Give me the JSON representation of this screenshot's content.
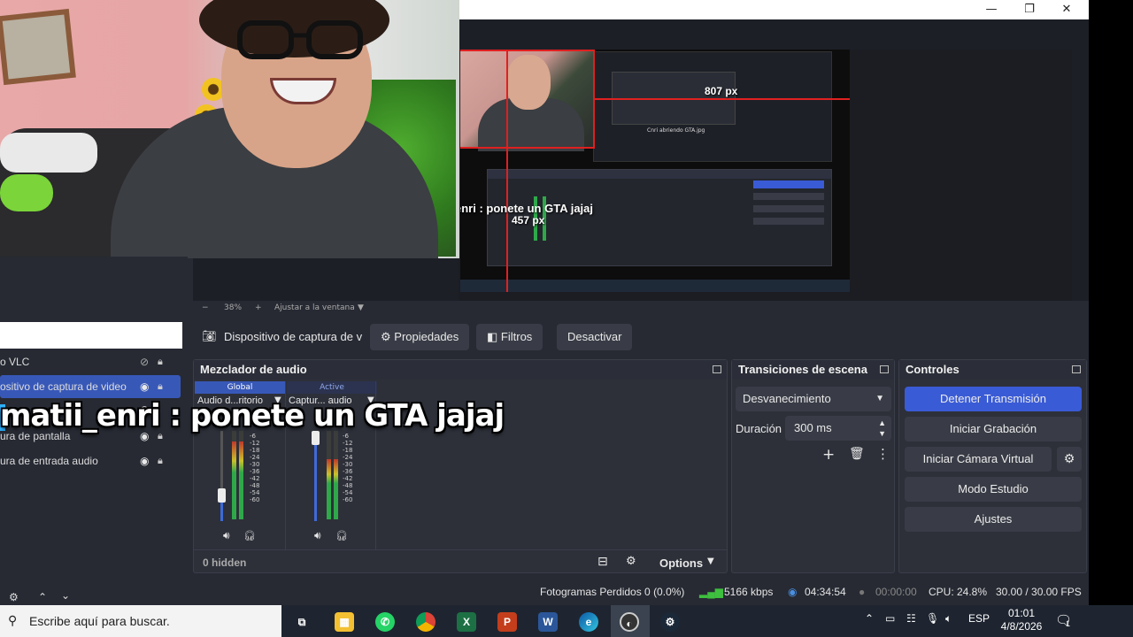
{
  "window": {
    "controls": [
      "—",
      "❐",
      "✕"
    ]
  },
  "preview": {
    "label_width": "807 px",
    "label_height": "457 px",
    "inner_chat": "enri : ponete un GTA jajaj",
    "inner_screen_label": "Cnri abriendo GTA.jpg"
  },
  "zoom": {
    "minus": "−",
    "value": "38%",
    "plus": "+",
    "fit": "Ajustar a la ventana"
  },
  "source_toolbar": {
    "source_name": "Dispositivo de captura de v",
    "properties": "Propiedades",
    "filters": "Filtros",
    "deactivate": "Desactivar"
  },
  "sources": {
    "items": [
      {
        "label": "o VLC",
        "selected": false
      },
      {
        "label": "ositivo de captura de video",
        "selected": true
      },
      {
        "label": "",
        "selected": false
      },
      {
        "label": "ura de pantalla",
        "selected": false
      },
      {
        "label": "ura de entrada audio",
        "selected": false
      }
    ]
  },
  "mixer": {
    "title": "Mezclador de audio",
    "tab_global": "Global",
    "tab_active": "Active",
    "channel1": "Audio d...ritorio",
    "channel2": "Captur... audio",
    "scale": [
      "-6",
      "-12",
      "-18",
      "-24",
      "-30",
      "-36",
      "-42",
      "-48",
      "-54",
      "-60"
    ],
    "hidden": "0 hidden",
    "options": "Options"
  },
  "transitions": {
    "title": "Transiciones de escena",
    "selected": "Desvanecimiento",
    "duration_label": "Duración",
    "duration_value": "300 ms"
  },
  "controls": {
    "title": "Controles",
    "stop_stream": "Detener Transmisión",
    "start_record": "Iniciar Grabación",
    "virtual_cam": "Iniciar Cámara Virtual",
    "studio": "Modo Estudio",
    "settings": "Ajustes"
  },
  "status": {
    "dropped": "Fotogramas Perdidos 0 (0.0%)",
    "bitrate": "5166 kbps",
    "stream_time": "04:34:54",
    "rec_time": "00:00:00",
    "cpu": "CPU: 24.8%",
    "fps": "30.00 / 30.00 FPS"
  },
  "chat_overlay": "matii_enri : ponete un GTA jajaj",
  "taskbar": {
    "search_placeholder": "Escribe aquí para buscar.",
    "language": "ESP",
    "time": "01:01",
    "date": "4/8/2026",
    "notifications": "1"
  },
  "colors": {
    "accent": "#3a5bd6",
    "panel": "#272a33",
    "dock": "#2d3039"
  }
}
